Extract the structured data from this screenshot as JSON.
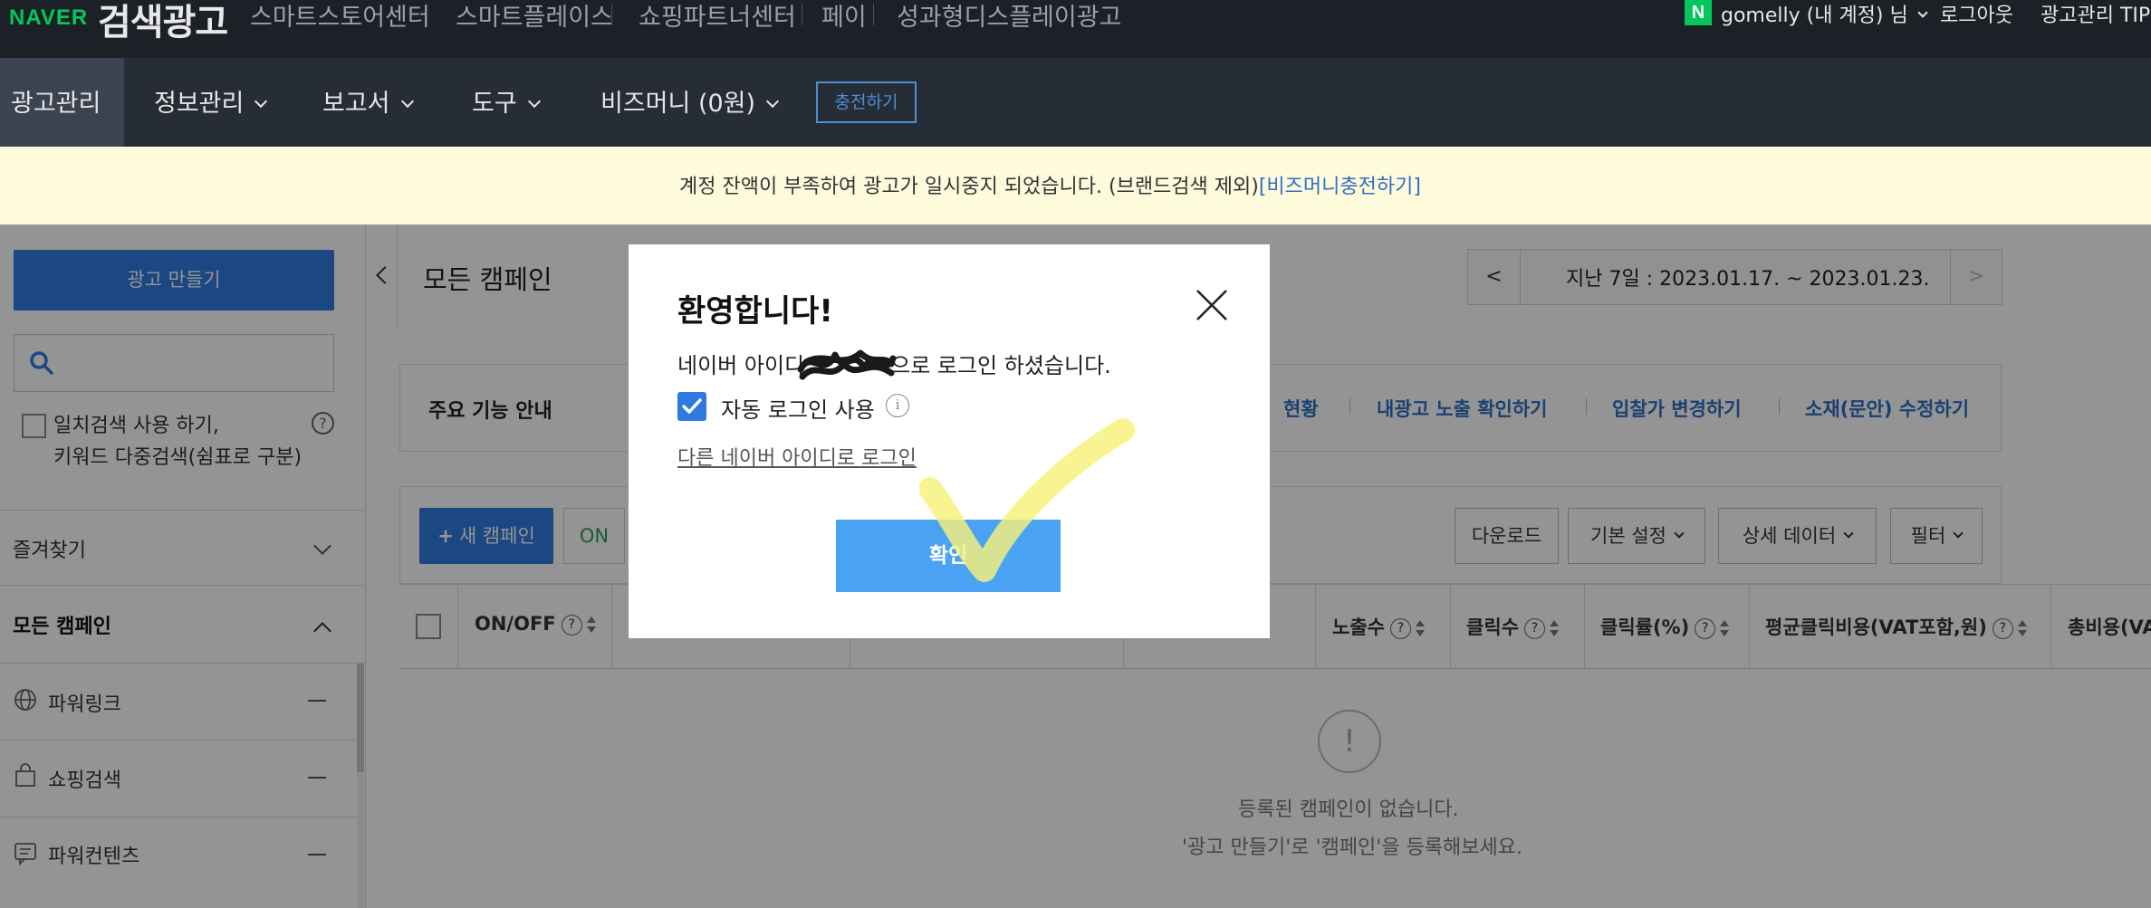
{
  "header": {
    "brand": "NAVER",
    "product": "검색광고",
    "links": [
      "스마트스토어센터",
      "스마트플레이스",
      "쇼핑파트너센터",
      "페이",
      "성과형디스플레이광고"
    ],
    "account_badge": "N",
    "account": "gomelly (내 계정) 님",
    "logout": "로그아웃",
    "tip": "광고관리 TIP"
  },
  "nav": {
    "items": [
      "광고관리",
      "정보관리",
      "보고서",
      "도구",
      "비즈머니 (0원)"
    ],
    "charge": "충전하기"
  },
  "notice": {
    "text": "계정 잔액이 부족하여 광고가 일시중지 되었습니다. (브랜드검색 제외)",
    "link": "[비즈머니충전하기]"
  },
  "sidebar": {
    "make_ad": "광고 만들기",
    "search_placeholder": "",
    "exact_line1": "일치검색 사용 하기,",
    "exact_line2": "키워드 다중검색(쉼표로 구분)",
    "help": "?",
    "favorites": "즐겨찾기",
    "all_campaigns": "모든 캠페인",
    "campaign_types": [
      "파워링크",
      "쇼핑검색",
      "파워컨텐츠"
    ]
  },
  "main": {
    "title": "모든 캠페인",
    "date_prev": "<",
    "date_range": "지난 7일 : 2023.01.17. ~ 2023.01.23.",
    "date_next": ">",
    "guide_title": "주요 기능 안내",
    "guide_links": [
      "현황",
      "내광고 노출 확인하기",
      "입찰가 변경하기",
      "소재(문안) 수정하기"
    ],
    "new_campaign": "새 캠페인",
    "on": "ON",
    "download": "다운로드",
    "basic_settings": "기본 설정",
    "detail_data": "상세 데이터",
    "filter": "필터",
    "columns": [
      "ON/OFF",
      "노출수",
      "클릭수",
      "클릭률(%)",
      "평균클릭비용(VAT포함,원)",
      "총비용(VA"
    ],
    "help": "?",
    "empty_icon": "!",
    "empty_line1": "등록된 캠페인이 없습니다.",
    "empty_line2": "'광고 만들기'로 '캠페인'을 등록해보세요."
  },
  "modal": {
    "title": "환영합니다!",
    "message_prefix": "네이버 아이디",
    "message_suffix": "으로 로그인 하셨습니다.",
    "auto_login": "자동 로그인 사용",
    "info": "i",
    "auto_login_checked": true,
    "other_login": "다른 네이버 아이디로 로그인",
    "confirm": "확인"
  },
  "colors": {
    "naver_green": "#03c75a",
    "primary_blue": "#2f7ae0",
    "confirm_blue": "#4aa3f2",
    "link_blue": "#2f6fc4",
    "notice_bg": "#fefbdc",
    "highlight_yellow": "#f6f17a"
  }
}
